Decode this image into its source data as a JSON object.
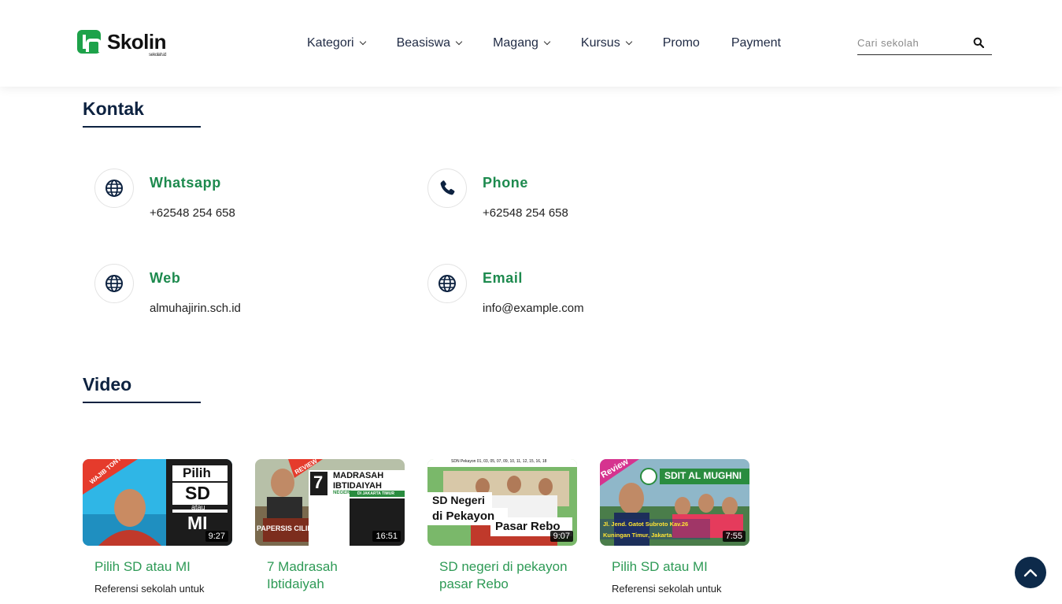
{
  "brand": {
    "name": "Skolin",
    "tagline": "sekolah.id"
  },
  "nav": [
    {
      "label": "Kategori",
      "dropdown": true
    },
    {
      "label": "Beasiswa",
      "dropdown": true
    },
    {
      "label": "Magang",
      "dropdown": true
    },
    {
      "label": "Kursus",
      "dropdown": true
    },
    {
      "label": "Promo",
      "dropdown": false
    },
    {
      "label": "Payment",
      "dropdown": false
    }
  ],
  "search": {
    "placeholder": "Cari sekolah",
    "icon": "search-icon"
  },
  "contact_section": {
    "title": "Kontak"
  },
  "contacts": [
    {
      "label": "Whatsapp",
      "value": "+62548 254 658",
      "icon": "globe-icon"
    },
    {
      "label": "Phone",
      "value": "+62548 254 658",
      "icon": "phone-icon"
    },
    {
      "label": "Web",
      "value": "almuhajirin.sch.id",
      "icon": "globe-icon"
    },
    {
      "label": "Email",
      "value": "info@example.com",
      "icon": "globe-icon"
    }
  ],
  "video_section": {
    "title": "Video"
  },
  "videos": [
    {
      "title": "Pilih SD atau MI",
      "duration": "9:27",
      "description": "Referensi sekolah untuk",
      "thumb_text": {
        "badge": "WAJIB TONTON",
        "line1": "Pilih",
        "line2": "SD",
        "line3": "atau",
        "line4": "MI"
      }
    },
    {
      "title": "7 Madrasah Ibtidaiyah",
      "duration": "16:51",
      "description": "",
      "thumb_text": {
        "badge": "REVIEW",
        "number": "7",
        "line1": "MADRASAH",
        "line2": "IBTIDAIYAH",
        "line3": "NEGERI",
        "line4": "DI JAKARTA TIMUR",
        "banner": "PAPERSIS CILIK"
      }
    },
    {
      "title": "SD negeri di pekayon pasar Rebo",
      "duration": "9:07",
      "description": "",
      "thumb_text": {
        "top": "SDN Pekayon 01, 03, 05, 07, 09, 10, 11, 12, 15, 16, 18",
        "line1": "SD Negeri",
        "line2": "di Pekayon",
        "line3": "Pasar Rebo"
      }
    },
    {
      "title": "Pilih SD atau MI",
      "duration": "7:55",
      "description": "Referensi sekolah untuk",
      "thumb_text": {
        "badge": "Review",
        "line1": "SDIT AL MUGHNI",
        "line2": "Jl. Jend. Gatot Subroto Kav.26",
        "line3": "Kuningan Timur, Jakarta"
      }
    }
  ],
  "colors": {
    "accent": "#1d8a4e",
    "heading": "#0d2240",
    "brand": "#1da24a"
  }
}
